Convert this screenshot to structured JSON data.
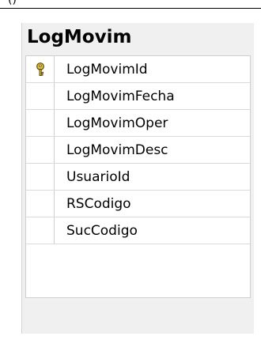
{
  "top_fragment": "()",
  "table": {
    "title": "LogMovim",
    "columns": [
      {
        "name": "LogMovimId",
        "primary_key": true,
        "icon": "key-icon"
      },
      {
        "name": "LogMovimFecha",
        "primary_key": false
      },
      {
        "name": "LogMovimOper",
        "primary_key": false
      },
      {
        "name": "LogMovimDesc",
        "primary_key": false
      },
      {
        "name": "UsuarioId",
        "primary_key": false
      },
      {
        "name": "RSCodigo",
        "primary_key": false
      },
      {
        "name": "SucCodigo",
        "primary_key": false
      }
    ]
  },
  "colors": {
    "panel_bg": "#f0f0f0",
    "key_icon": "#c9a21f"
  }
}
